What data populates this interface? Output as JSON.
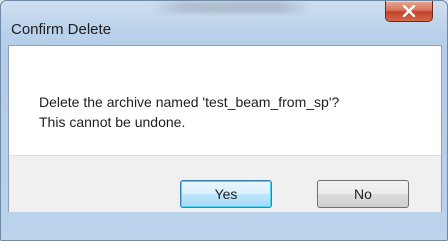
{
  "dialog": {
    "title": "Confirm Delete",
    "message_line1": "Delete the archive named 'test_beam_from_sp'?",
    "message_line2": "This cannot be undone.",
    "buttons": {
      "yes_label": "Yes",
      "no_label": "No"
    },
    "close_icon": "close-x-icon"
  }
}
